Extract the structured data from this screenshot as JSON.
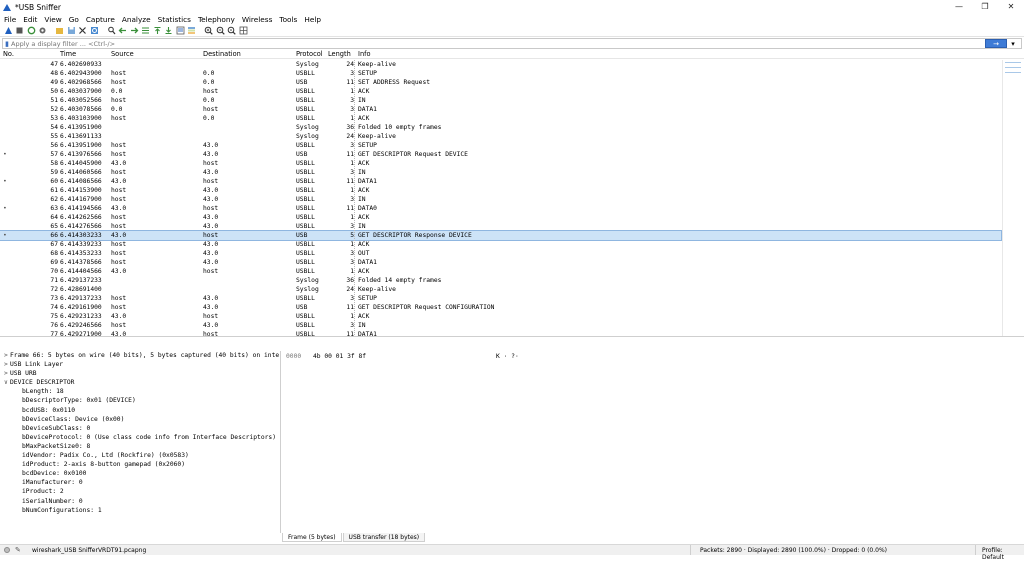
{
  "window": {
    "title": "*USB Sniffer",
    "controls": [
      "—",
      "❐",
      "✕"
    ]
  },
  "menu": [
    "File",
    "Edit",
    "View",
    "Go",
    "Capture",
    "Analyze",
    "Statistics",
    "Telephony",
    "Wireless",
    "Tools",
    "Help"
  ],
  "filter": {
    "placeholder": "Apply a display filter ... <Ctrl-/>",
    "apply_glyph": "→",
    "dropdown_glyph": "▾"
  },
  "columns": {
    "no": "No.",
    "time": "Time",
    "source": "Source",
    "destination": "Destination",
    "protocol": "Protocol",
    "length": "Length",
    "info": "Info"
  },
  "packets": [
    {
      "mark": "",
      "no": "47",
      "time": "6.402690933",
      "src": "",
      "dst": "",
      "proto": "Syslog",
      "len": "24",
      "info": "Keep-alive"
    },
    {
      "mark": "",
      "no": "48",
      "time": "6.402943900",
      "src": "host",
      "dst": "0.0",
      "proto": "USBLL",
      "len": "3",
      "info": "SETUP"
    },
    {
      "mark": "",
      "no": "49",
      "time": "6.402968566",
      "src": "host",
      "dst": "0.0",
      "proto": "USB",
      "len": "11",
      "info": "SET ADDRESS Request"
    },
    {
      "mark": "",
      "no": "50",
      "time": "6.403037900",
      "src": "0.0",
      "dst": "host",
      "proto": "USBLL",
      "len": "1",
      "info": "ACK"
    },
    {
      "mark": "",
      "no": "51",
      "time": "6.403052566",
      "src": "host",
      "dst": "0.0",
      "proto": "USBLL",
      "len": "3",
      "info": "IN"
    },
    {
      "mark": "",
      "no": "52",
      "time": "6.403078566",
      "src": "0.0",
      "dst": "host",
      "proto": "USBLL",
      "len": "3",
      "info": "DATA1"
    },
    {
      "mark": "",
      "no": "53",
      "time": "6.403103900",
      "src": "host",
      "dst": "0.0",
      "proto": "USBLL",
      "len": "1",
      "info": "ACK"
    },
    {
      "mark": "",
      "no": "54",
      "time": "6.413951900",
      "src": "",
      "dst": "",
      "proto": "Syslog",
      "len": "36",
      "info": "Folded 10 empty frames"
    },
    {
      "mark": "",
      "no": "55",
      "time": "6.413691133",
      "src": "",
      "dst": "",
      "proto": "Syslog",
      "len": "24",
      "info": "Keep-alive"
    },
    {
      "mark": "",
      "no": "56",
      "time": "6.413951900",
      "src": "host",
      "dst": "43.0",
      "proto": "USBLL",
      "len": "3",
      "info": "SETUP"
    },
    {
      "mark": "•",
      "no": "57",
      "time": "6.413976566",
      "src": "host",
      "dst": "43.0",
      "proto": "USB",
      "len": "11",
      "info": "GET DESCRIPTOR Request DEVICE"
    },
    {
      "mark": "",
      "no": "58",
      "time": "6.414045900",
      "src": "43.0",
      "dst": "host",
      "proto": "USBLL",
      "len": "1",
      "info": "ACK"
    },
    {
      "mark": "",
      "no": "59",
      "time": "6.414060566",
      "src": "host",
      "dst": "43.0",
      "proto": "USBLL",
      "len": "3",
      "info": "IN"
    },
    {
      "mark": "•",
      "no": "60",
      "time": "6.414086566",
      "src": "43.0",
      "dst": "host",
      "proto": "USBLL",
      "len": "11",
      "info": "DATA1"
    },
    {
      "mark": "",
      "no": "61",
      "time": "6.414153900",
      "src": "host",
      "dst": "43.0",
      "proto": "USBLL",
      "len": "1",
      "info": "ACK"
    },
    {
      "mark": "",
      "no": "62",
      "time": "6.414167900",
      "src": "host",
      "dst": "43.0",
      "proto": "USBLL",
      "len": "3",
      "info": "IN"
    },
    {
      "mark": "•",
      "no": "63",
      "time": "6.414194566",
      "src": "43.0",
      "dst": "host",
      "proto": "USBLL",
      "len": "11",
      "info": "DATA0"
    },
    {
      "mark": "",
      "no": "64",
      "time": "6.414262566",
      "src": "host",
      "dst": "43.0",
      "proto": "USBLL",
      "len": "1",
      "info": "ACK"
    },
    {
      "mark": "",
      "no": "65",
      "time": "6.414276566",
      "src": "host",
      "dst": "43.0",
      "proto": "USBLL",
      "len": "3",
      "info": "IN"
    },
    {
      "mark": "•",
      "no": "66",
      "time": "6.414303233",
      "src": "43.0",
      "dst": "host",
      "proto": "USB",
      "len": "5",
      "info": "GET DESCRIPTOR Response DEVICE",
      "selected": true
    },
    {
      "mark": "",
      "no": "67",
      "time": "6.414339233",
      "src": "host",
      "dst": "43.0",
      "proto": "USBLL",
      "len": "1",
      "info": "ACK"
    },
    {
      "mark": "",
      "no": "68",
      "time": "6.414353233",
      "src": "host",
      "dst": "43.0",
      "proto": "USBLL",
      "len": "3",
      "info": "OUT"
    },
    {
      "mark": "",
      "no": "69",
      "time": "6.414378566",
      "src": "host",
      "dst": "43.0",
      "proto": "USBLL",
      "len": "3",
      "info": "DATA1"
    },
    {
      "mark": "",
      "no": "70",
      "time": "6.414404566",
      "src": "43.0",
      "dst": "host",
      "proto": "USBLL",
      "len": "1",
      "info": "ACK"
    },
    {
      "mark": "",
      "no": "71",
      "time": "6.429137233",
      "src": "",
      "dst": "",
      "proto": "Syslog",
      "len": "36",
      "info": "Folded 14 empty frames"
    },
    {
      "mark": "",
      "no": "72",
      "time": "6.428691400",
      "src": "",
      "dst": "",
      "proto": "Syslog",
      "len": "24",
      "info": "Keep-alive"
    },
    {
      "mark": "",
      "no": "73",
      "time": "6.429137233",
      "src": "host",
      "dst": "43.0",
      "proto": "USBLL",
      "len": "3",
      "info": "SETUP"
    },
    {
      "mark": "",
      "no": "74",
      "time": "6.429161900",
      "src": "host",
      "dst": "43.0",
      "proto": "USB",
      "len": "11",
      "info": "GET DESCRIPTOR Request CONFIGURATION"
    },
    {
      "mark": "",
      "no": "75",
      "time": "6.429231233",
      "src": "43.0",
      "dst": "host",
      "proto": "USBLL",
      "len": "1",
      "info": "ACK"
    },
    {
      "mark": "",
      "no": "76",
      "time": "6.429246566",
      "src": "host",
      "dst": "43.0",
      "proto": "USBLL",
      "len": "3",
      "info": "IN"
    },
    {
      "mark": "",
      "no": "77",
      "time": "6.429271900",
      "src": "43.0",
      "dst": "host",
      "proto": "USBLL",
      "len": "11",
      "info": "DATA1"
    }
  ],
  "details": [
    {
      "arrow": ">",
      "indent": 0,
      "text": "Frame 66: 5 bytes on wire (40 bits), 5 bytes captured (40 bits) on inte"
    },
    {
      "arrow": ">",
      "indent": 0,
      "text": "USB Link Layer"
    },
    {
      "arrow": ">",
      "indent": 0,
      "text": "USB URB"
    },
    {
      "arrow": "∨",
      "indent": 0,
      "text": "DEVICE DESCRIPTOR"
    },
    {
      "arrow": "",
      "indent": 1,
      "text": "bLength: 18"
    },
    {
      "arrow": "",
      "indent": 1,
      "text": "bDescriptorType: 0x01 (DEVICE)"
    },
    {
      "arrow": "",
      "indent": 1,
      "text": "bcdUSB: 0x0110"
    },
    {
      "arrow": "",
      "indent": 1,
      "text": "bDeviceClass: Device (0x00)"
    },
    {
      "arrow": "",
      "indent": 1,
      "text": "bDeviceSubClass: 0"
    },
    {
      "arrow": "",
      "indent": 1,
      "text": "bDeviceProtocol: 0 (Use class code info from Interface Descriptors)"
    },
    {
      "arrow": "",
      "indent": 1,
      "text": "bMaxPacketSize0: 8"
    },
    {
      "arrow": "",
      "indent": 1,
      "text": "idVendor: Padix Co., Ltd (Rockfire) (0x0583)"
    },
    {
      "arrow": "",
      "indent": 1,
      "text": "idProduct: 2-axis 8-button gamepad (0x2060)"
    },
    {
      "arrow": "",
      "indent": 1,
      "text": "bcdDevice: 0x0100"
    },
    {
      "arrow": "",
      "indent": 1,
      "text": "iManufacturer: 0"
    },
    {
      "arrow": "",
      "indent": 1,
      "text": "iProduct: 2"
    },
    {
      "arrow": "",
      "indent": 1,
      "text": "iSerialNumber: 0"
    },
    {
      "arrow": "",
      "indent": 1,
      "text": "bNumConfigurations: 1"
    }
  ],
  "hex": {
    "offset": "0000",
    "bytes": "4b 00 01 3f 8f",
    "ascii": "K · ?·"
  },
  "bytes_tabs": [
    "Frame (5 bytes)",
    "USB transfer (18 bytes)"
  ],
  "status": {
    "file": "wireshark_USB SnifferVRDT91.pcapng",
    "packets": "Packets: 2890 · Displayed: 2890 (100.0%) · Dropped: 0 (0.0%)",
    "profile": "Profile: Default"
  }
}
